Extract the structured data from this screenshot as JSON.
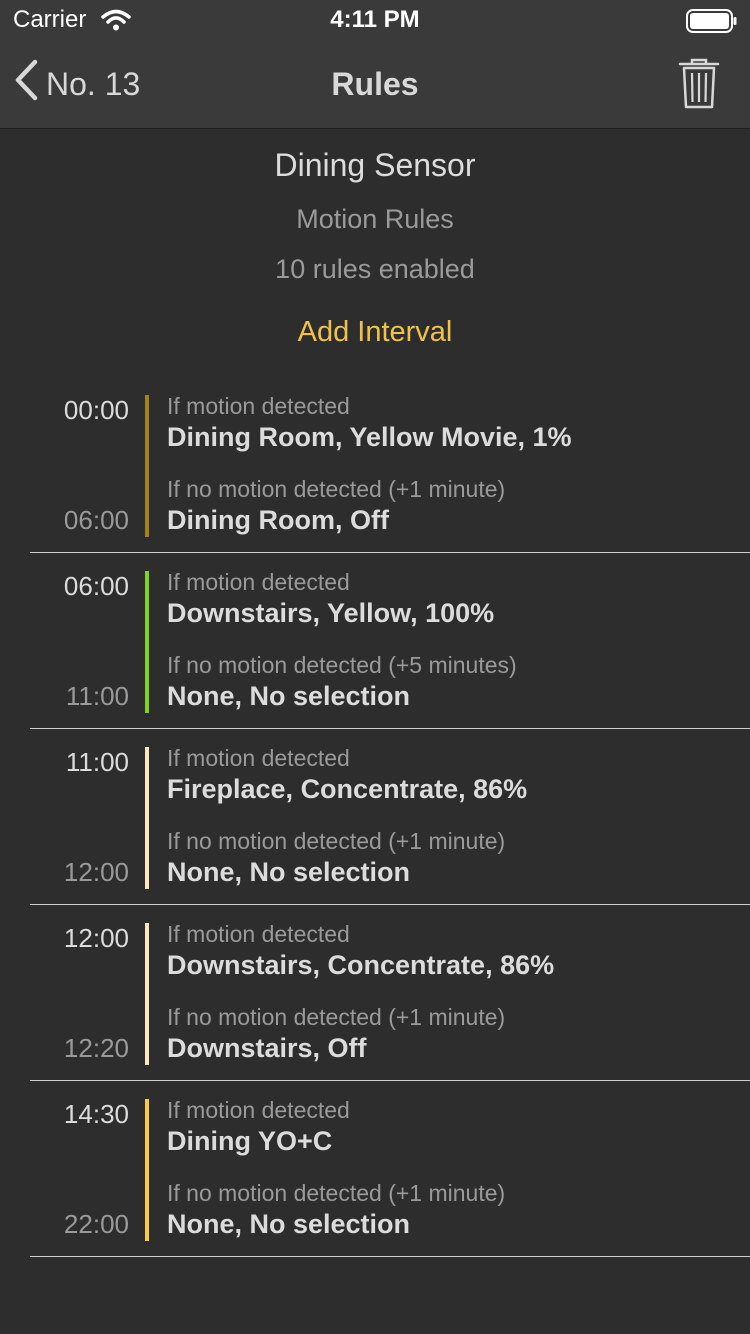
{
  "status_bar": {
    "carrier": "Carrier",
    "time": "4:11 PM"
  },
  "nav": {
    "back_label": "No. 13",
    "title": "Rules",
    "back_icon": "chevron-left-icon",
    "trash_icon": "trash-icon"
  },
  "header": {
    "sensor_name": "Dining Sensor",
    "rules_type": "Motion Rules",
    "rules_count": "10 rules enabled",
    "add_interval_label": "Add Interval"
  },
  "colors": {
    "accent": "#f0c24a",
    "background": "#2d2d2d",
    "bar": "#3a3a3a"
  },
  "rules": [
    {
      "start": "00:00",
      "end": "06:00",
      "color": "#a4801e",
      "motion_label": "If motion detected",
      "motion_scene": "Dining Room, Yellow Movie, 1%",
      "nomotion_label": "If no motion detected (+1 minute)",
      "nomotion_scene": "Dining Room, Off"
    },
    {
      "start": "06:00",
      "end": "11:00",
      "color": "#7ed321",
      "motion_label": "If motion detected",
      "motion_scene": "Downstairs, Yellow, 100%",
      "nomotion_label": "If no motion detected (+5 minutes)",
      "nomotion_scene": "None, No selection"
    },
    {
      "start": "11:00",
      "end": "12:00",
      "color": "#fbe8c0",
      "motion_label": "If motion detected",
      "motion_scene": "Fireplace, Concentrate, 86%",
      "nomotion_label": "If no motion detected (+1 minute)",
      "nomotion_scene": "None, No selection"
    },
    {
      "start": "12:00",
      "end": "12:20",
      "color": "#fbe8c0",
      "motion_label": "If motion detected",
      "motion_scene": "Downstairs, Concentrate, 86%",
      "nomotion_label": "If no motion detected (+1 minute)",
      "nomotion_scene": "Downstairs, Off"
    },
    {
      "start": "14:30",
      "end": "22:00",
      "color": "#f6cc4a",
      "motion_label": "If motion detected",
      "motion_scene": "Dining YO+C",
      "nomotion_label": "If no motion detected (+1 minute)",
      "nomotion_scene": "None, No selection"
    }
  ]
}
